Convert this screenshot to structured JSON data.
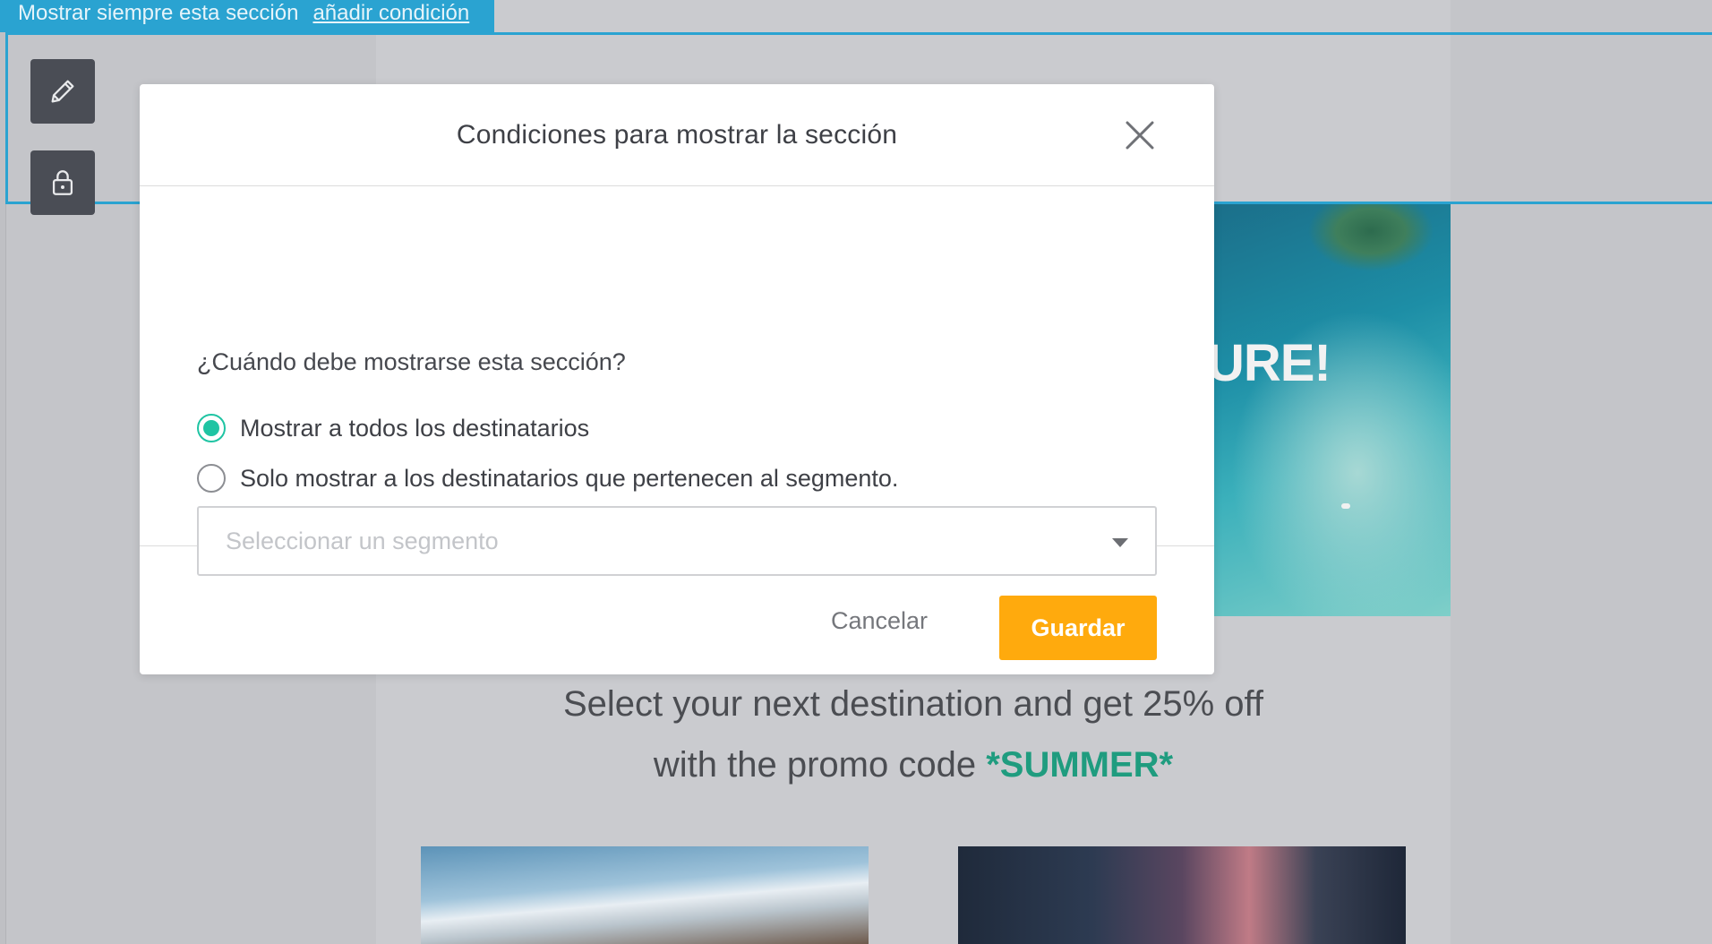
{
  "section_bar": {
    "status": "Mostrar siempre esta sección",
    "add_condition": "añadir condición"
  },
  "toolbar": {
    "edit_icon": "pencil-icon",
    "lock_icon": "lock-icon"
  },
  "background": {
    "hero_text": "URE!",
    "promo_line1": "Select your next destination and get 25% off",
    "promo_line2_prefix": "with the promo code ",
    "promo_code": "*SUMMER*"
  },
  "modal": {
    "title": "Condiciones para mostrar la sección",
    "close_icon": "close-icon",
    "question": "¿Cuándo debe mostrarse esta sección?",
    "options": [
      {
        "label": "Mostrar a todos los destinatarios",
        "selected": true
      },
      {
        "label": "Solo mostrar a los destinatarios que pertenecen al segmento.",
        "selected": false
      }
    ],
    "segment_select": {
      "placeholder": "Seleccionar un segmento",
      "caret_icon": "caret-down-icon"
    },
    "cancel_label": "Cancelar",
    "save_label": "Guardar"
  },
  "colors": {
    "accent_blue": "#2aa3d1",
    "radio_selected": "#1fc4a3",
    "save_button": "#ffaa0d",
    "promo_code": "#1f9c7f"
  }
}
